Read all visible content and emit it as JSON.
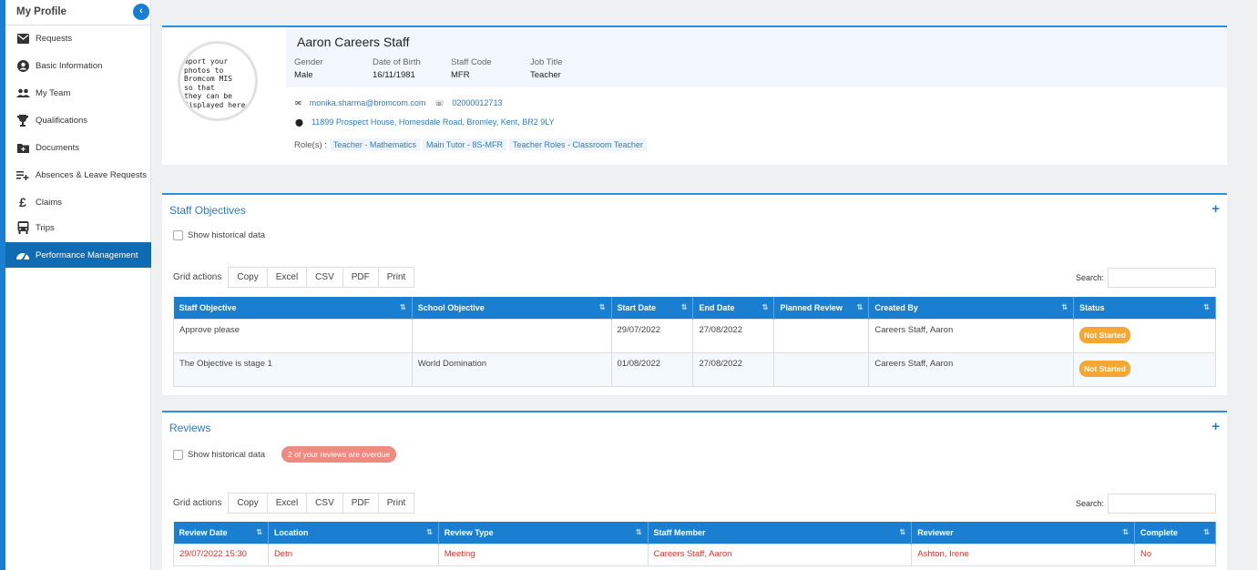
{
  "sidebar": {
    "title": "My Profile",
    "collapse_icon": "chevron-left-icon",
    "items": [
      {
        "label": "Requests",
        "icon": "envelope-icon"
      },
      {
        "label": "Basic Information",
        "icon": "user-circle-icon"
      },
      {
        "label": "My Team",
        "icon": "people-icon"
      },
      {
        "label": "Qualifications",
        "icon": "trophy-icon"
      },
      {
        "label": "Documents",
        "icon": "folder-icon"
      },
      {
        "label": "Absences & Leave Requests",
        "icon": "playlist-add-icon"
      },
      {
        "label": "Claims",
        "icon": "pound-icon"
      },
      {
        "label": "Trips",
        "icon": "bus-icon"
      },
      {
        "label": "Performance Management",
        "icon": "speedometer-icon"
      }
    ],
    "active_index": 8
  },
  "profile": {
    "photo_text": "mport your\nphotos to\nBromcom MIS\nso that\nthey can be\ndisplayed here",
    "name": "Aaron Careers Staff",
    "fields": [
      {
        "label": "Gender",
        "value": "Male"
      },
      {
        "label": "Date of Birth",
        "value": "16/11/1981"
      },
      {
        "label": "Staff Code",
        "value": "MFR"
      },
      {
        "label": "Job Title",
        "value": "Teacher"
      }
    ],
    "email": "monika.sharma@bromcom.com",
    "phone": "02000012713",
    "address": "11899 Prospect House, Homesdale Road, Bromley, Kent, BR2 9LY",
    "roles_label": "Role(s) :",
    "roles": [
      "Teacher - Mathematics",
      "Main Tutor - 8S-MFR",
      "Teacher Roles - Classroom Teacher"
    ]
  },
  "objectives": {
    "title": "Staff Objectives",
    "show_historical": "Show historical data",
    "grid_actions_label": "Grid actions",
    "grid_actions": [
      "Copy",
      "Excel",
      "CSV",
      "PDF",
      "Print"
    ],
    "search_label": "Search:",
    "columns": [
      "Staff Objective",
      "School Objective",
      "Start Date",
      "End Date",
      "Planned Review",
      "Created By",
      "Status"
    ],
    "rows": [
      [
        "Approve please",
        "",
        "29/07/2022",
        "27/08/2022",
        "",
        "Careers Staff, Aaron",
        "Not Started"
      ],
      [
        "The Objective is stage 1",
        "World Domination",
        "01/08/2022",
        "27/08/2022",
        "",
        "Careers Staff, Aaron",
        "Not Started"
      ]
    ]
  },
  "reviews": {
    "title": "Reviews",
    "show_historical": "Show historical data",
    "overdue_badge": "2 of your reviews are overdue",
    "grid_actions_label": "Grid actions",
    "grid_actions": [
      "Copy",
      "Excel",
      "CSV",
      "PDF",
      "Print"
    ],
    "search_label": "Search:",
    "columns": [
      "Review Date",
      "Location",
      "Review Type",
      "Staff Member",
      "Reviewer",
      "Complete"
    ],
    "rows": [
      [
        "29/07/2022 15:30",
        "Detn",
        "Meeting",
        "Careers Staff, Aaron",
        "Ashton, Irene",
        "No"
      ]
    ]
  },
  "colors": {
    "primary": "#1a7fd0",
    "link": "#2b7cc4",
    "status_not_started": "#f4a833",
    "overdue": "#ef8a80",
    "overdue_text": "#d9342b"
  }
}
